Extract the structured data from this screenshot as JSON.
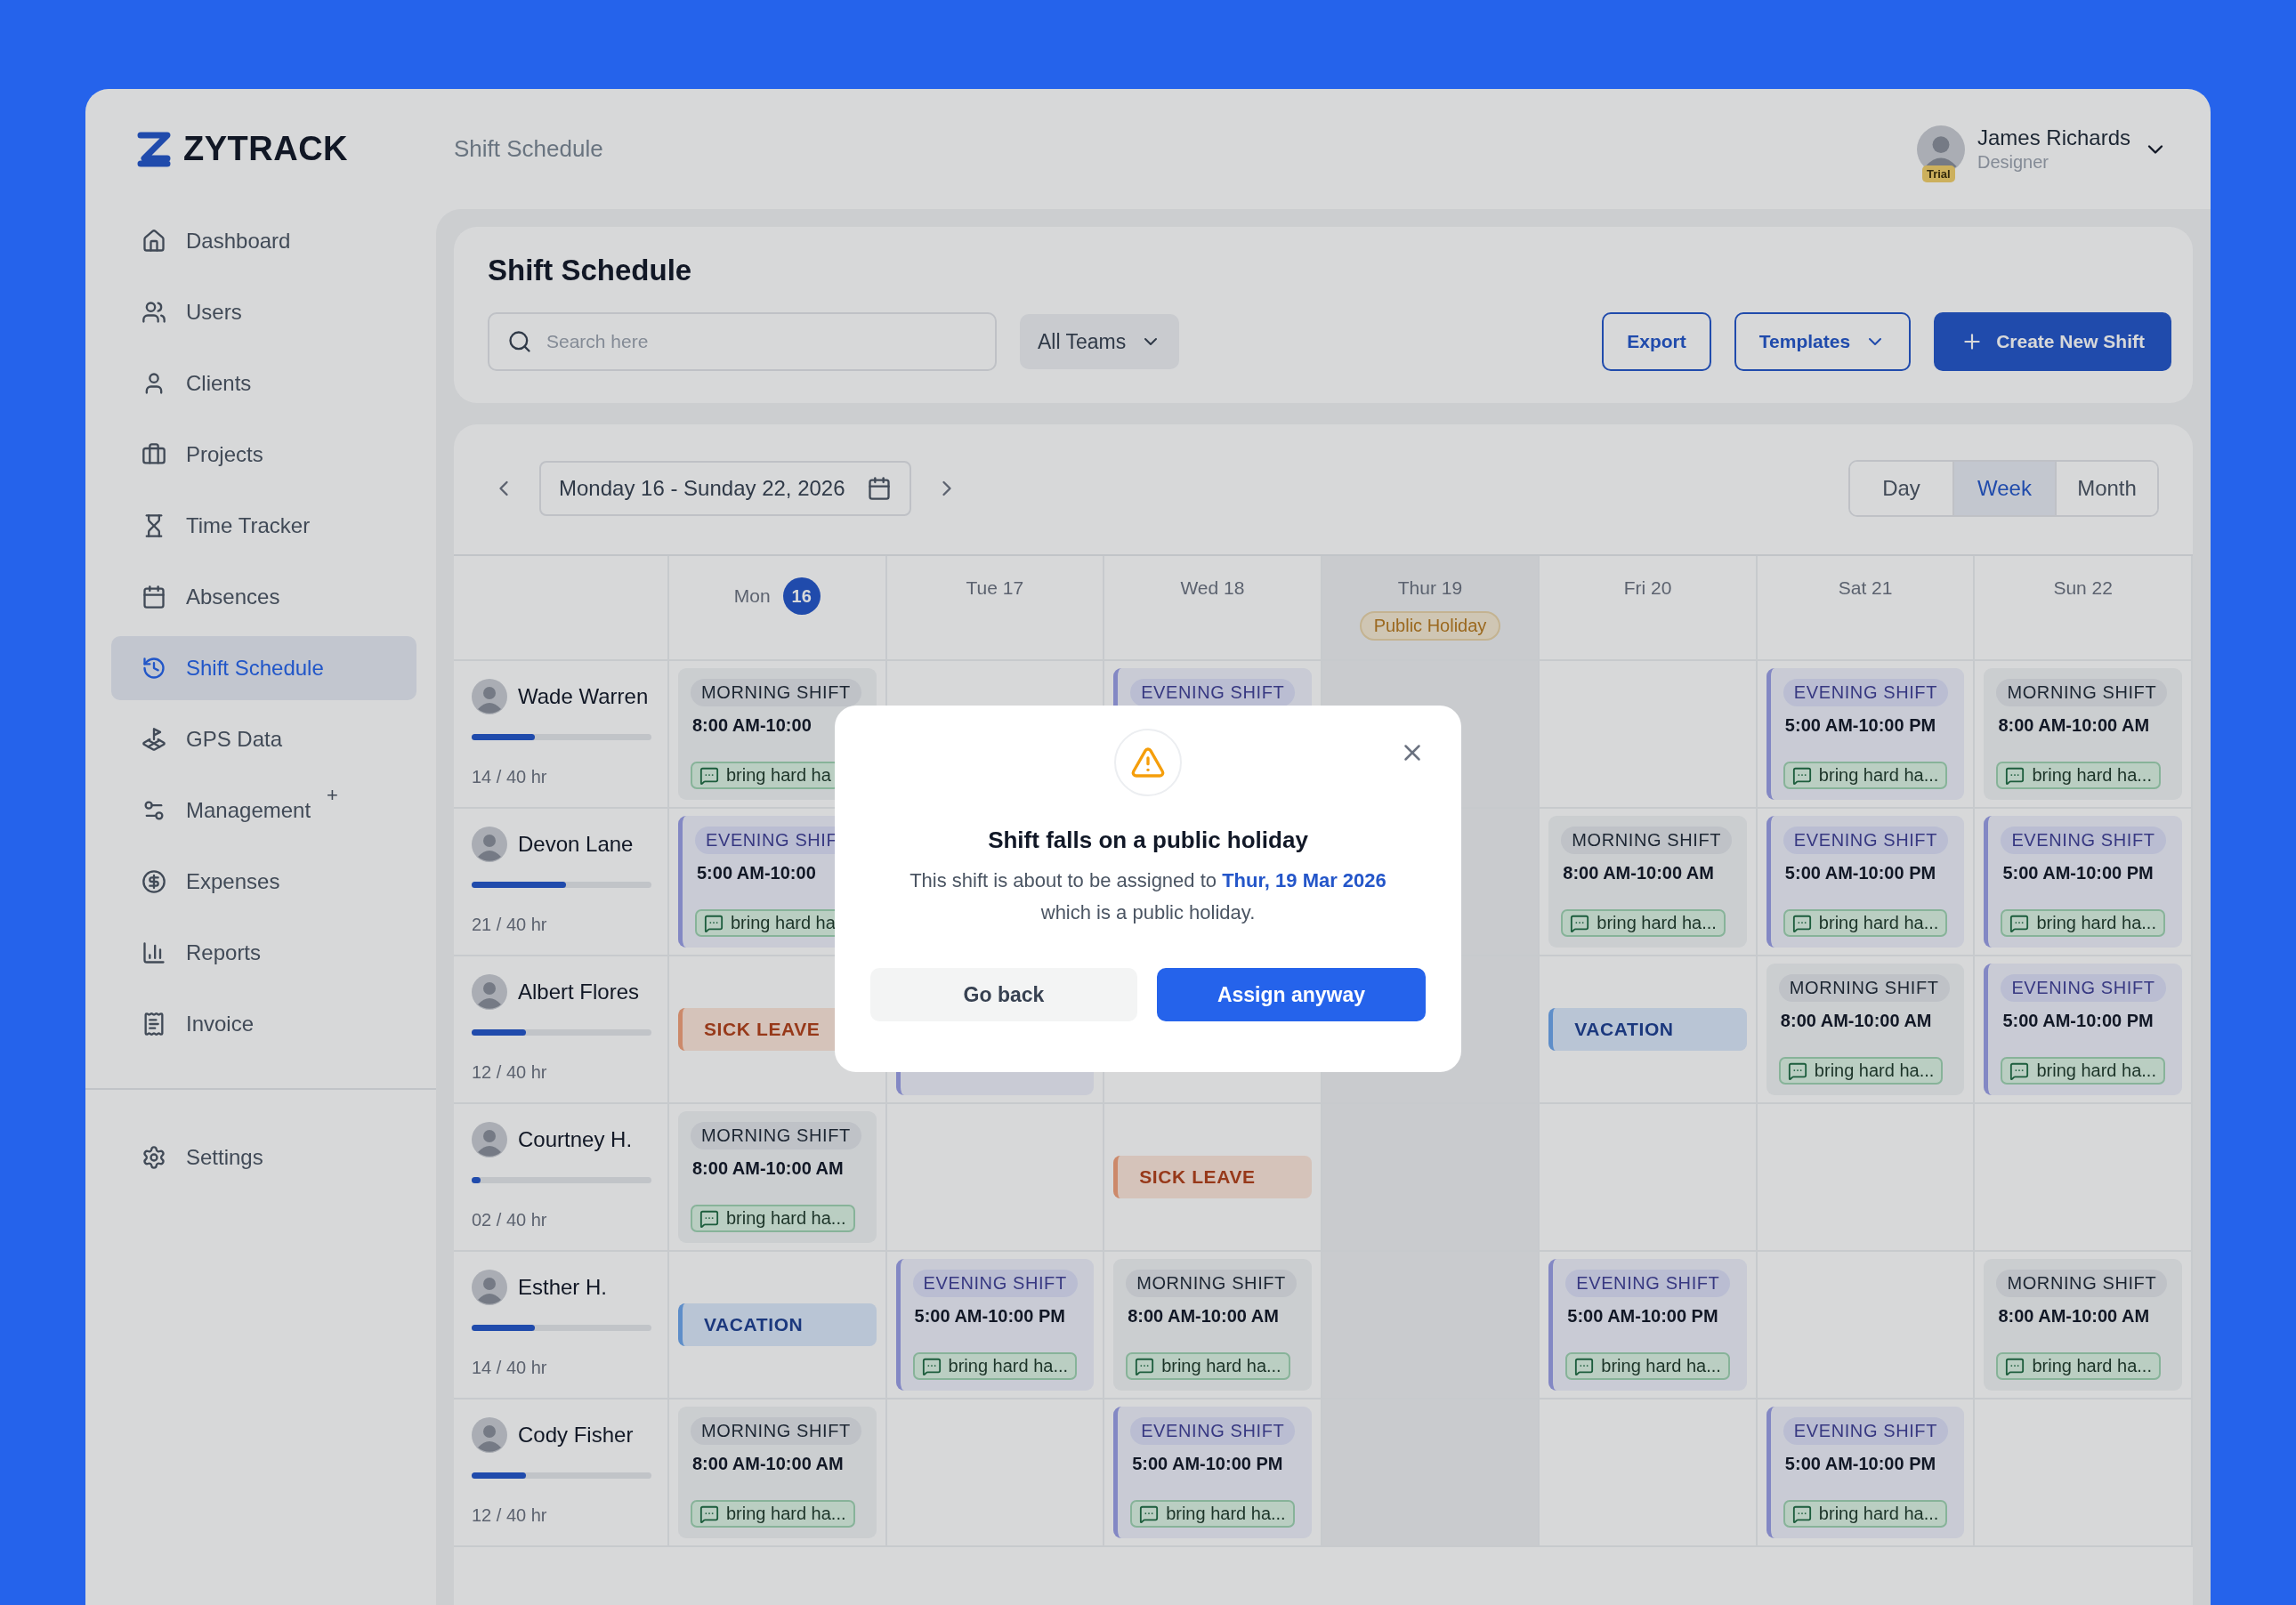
{
  "app": {
    "logo": "ZYTRACK"
  },
  "sidebar": {
    "items": [
      {
        "label": "Dashboard",
        "selected": false
      },
      {
        "label": "Users",
        "selected": false
      },
      {
        "label": "Clients",
        "selected": false
      },
      {
        "label": "Projects",
        "selected": false
      },
      {
        "label": "Time Tracker",
        "selected": false
      },
      {
        "label": "Absences",
        "selected": false
      },
      {
        "label": "Shift Schedule",
        "selected": true
      },
      {
        "label": "GPS Data",
        "selected": false
      },
      {
        "label": "Management",
        "selected": false,
        "badge": "+"
      },
      {
        "label": "Expenses",
        "selected": false
      },
      {
        "label": "Reports",
        "selected": false
      },
      {
        "label": "Invoice",
        "selected": false
      }
    ],
    "footer_items": [
      {
        "label": "Settings",
        "selected": false
      }
    ]
  },
  "header": {
    "title": "Shift Schedule",
    "user": {
      "name": "James Richards",
      "role": "Designer",
      "badge": "Trial"
    }
  },
  "page": {
    "title": "Shift Schedule",
    "search": {
      "placeholder": "Search here"
    },
    "team_filter": "All Teams",
    "buttons": {
      "export": "Export",
      "templates": "Templates",
      "create": "Create New Shift"
    }
  },
  "schedule": {
    "range": "Monday 16 - Sunday 22, 2026",
    "views": [
      {
        "label": "Day",
        "selected": false
      },
      {
        "label": "Week",
        "selected": true
      },
      {
        "label": "Month",
        "selected": false
      }
    ],
    "days": [
      {
        "day": "Mon",
        "date": "16",
        "today": true
      },
      {
        "day": "Tue",
        "date": "17",
        "today": false
      },
      {
        "day": "Wed",
        "date": "18",
        "today": false
      },
      {
        "day": "Thur",
        "date": "19",
        "today": false,
        "holiday": "Public Holiday"
      },
      {
        "day": "Fri",
        "date": "20",
        "today": false
      },
      {
        "day": "Sat",
        "date": "21",
        "today": false
      },
      {
        "day": "Sun",
        "date": "22",
        "today": false
      }
    ],
    "staff": [
      {
        "name": "Wade Warren",
        "level": 0.35,
        "hours": "14 / 40 hr",
        "cells": [
          {
            "kind": "morning",
            "tag": "MORNING SHIFT",
            "time": "8:00 AM-10:00",
            "note": "bring hard ha"
          },
          {
            "kind": "empty"
          },
          {
            "kind": "evening",
            "tag": "EVENING SHIFT"
          },
          {
            "kind": "empty"
          },
          {
            "kind": "empty"
          },
          {
            "kind": "evening",
            "tag": "EVENING SHIFT",
            "time": "5:00 AM-10:00 PM",
            "note": "bring hard ha..."
          },
          {
            "kind": "morning",
            "tag": "MORNING SHIFT",
            "time": "8:00 AM-10:00 AM",
            "note": "bring hard ha..."
          }
        ]
      },
      {
        "name": "Devon Lane",
        "level": 0.525,
        "hours": "21 / 40 hr",
        "cells": [
          {
            "kind": "evening",
            "tag": "EVENING SHIF",
            "time": "5:00 AM-10:00",
            "note": "bring hard ha"
          },
          {
            "kind": "hidden"
          },
          {
            "kind": "hidden"
          },
          {
            "kind": "empty"
          },
          {
            "kind": "morning",
            "tag": "MORNING SHIFT",
            "time": "8:00 AM-10:00 AM",
            "note": "bring hard ha..."
          },
          {
            "kind": "evening",
            "tag": "EVENING SHIFT",
            "time": "5:00 AM-10:00 PM",
            "note": "bring hard ha..."
          },
          {
            "kind": "evening",
            "tag": "EVENING SHIFT",
            "time": "5:00 AM-10:00 PM",
            "note": "bring hard ha..."
          }
        ]
      },
      {
        "name": "Albert Flores",
        "level": 0.3,
        "hours": "12 / 40 hr",
        "cells": [
          {
            "kind": "sick",
            "label": "SICK LEAVE"
          },
          {
            "kind": "evening"
          },
          {
            "kind": "empty"
          },
          {
            "kind": "empty"
          },
          {
            "kind": "vacation",
            "label": "VACATION"
          },
          {
            "kind": "morning",
            "tag": "MORNING SHIFT",
            "time": "8:00 AM-10:00 AM",
            "note": "bring hard ha..."
          },
          {
            "kind": "evening",
            "tag": "EVENING SHIFT",
            "time": "5:00 AM-10:00 PM",
            "note": "bring hard ha..."
          }
        ]
      },
      {
        "name": "Courtney H.",
        "level": 0.05,
        "hours": "02 / 40 hr",
        "cells": [
          {
            "kind": "morning",
            "tag": "MORNING SHIFT",
            "time": "8:00 AM-10:00 AM",
            "note": "bring hard ha..."
          },
          {
            "kind": "empty"
          },
          {
            "kind": "sick",
            "label": "SICK LEAVE"
          },
          {
            "kind": "empty"
          },
          {
            "kind": "empty"
          },
          {
            "kind": "empty"
          },
          {
            "kind": "empty"
          }
        ]
      },
      {
        "name": "Esther H.",
        "level": 0.35,
        "hours": "14 / 40 hr",
        "cells": [
          {
            "kind": "vacation",
            "label": "VACATION"
          },
          {
            "kind": "evening",
            "tag": "EVENING SHIFT",
            "time": "5:00 AM-10:00 PM",
            "note": "bring hard ha..."
          },
          {
            "kind": "morning",
            "tag": "MORNING SHIFT",
            "time": "8:00 AM-10:00 AM",
            "note": "bring hard ha..."
          },
          {
            "kind": "empty"
          },
          {
            "kind": "evening",
            "tag": "EVENING SHIFT",
            "time": "5:00 AM-10:00 PM",
            "note": "bring hard ha..."
          },
          {
            "kind": "empty"
          },
          {
            "kind": "morning",
            "tag": "MORNING SHIFT",
            "time": "8:00 AM-10:00 AM",
            "note": "bring hard ha..."
          }
        ]
      },
      {
        "name": "Cody Fisher",
        "level": 0.3,
        "hours": "12 / 40 hr",
        "cells": [
          {
            "kind": "morning",
            "tag": "MORNING SHIFT",
            "time": "8:00 AM-10:00 AM",
            "note": "bring hard ha..."
          },
          {
            "kind": "empty"
          },
          {
            "kind": "evening",
            "tag": "EVENING SHIFT",
            "time": "5:00 AM-10:00 PM",
            "note": "bring hard ha..."
          },
          {
            "kind": "empty"
          },
          {
            "kind": "empty"
          },
          {
            "kind": "evening",
            "tag": "EVENING SHIFT",
            "time": "5:00 AM-10:00 PM",
            "note": "bring hard ha..."
          },
          {
            "kind": "empty"
          }
        ]
      }
    ]
  },
  "dialog": {
    "title": "Shift falls on a public holiday",
    "message": "This shift is about to be assigned to **Thur, 19 Mar 2026** which is a public holiday.",
    "buttons": {
      "cancel": "Go back",
      "confirm": "Assign anyway"
    }
  }
}
